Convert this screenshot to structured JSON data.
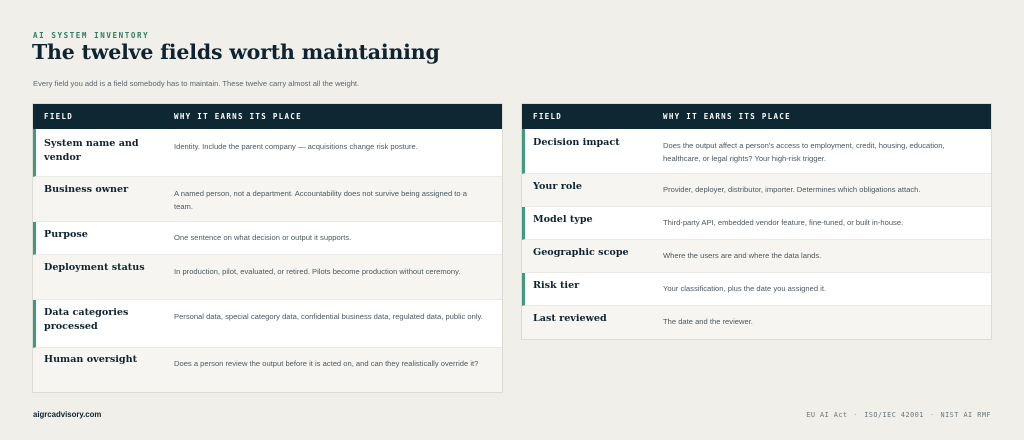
{
  "header": {
    "eyebrow": "AI SYSTEM INVENTORY",
    "title": "The twelve fields worth maintaining",
    "subtitle": "Every field you add is a field somebody has to maintain. These twelve carry almost all the weight."
  },
  "table_headers": {
    "field": "FIELD",
    "why": "WHY IT EARNS ITS PLACE"
  },
  "left_table": {
    "rows": [
      {
        "field": "System name and vendor",
        "why": "Identity. Include the parent company — acquisitions change risk posture."
      },
      {
        "field": "Business owner",
        "why": "A named person, not a department. Accountability does not survive being assigned to a team."
      },
      {
        "field": "Purpose",
        "why": "One sentence on what decision or output it supports."
      },
      {
        "field": "Deployment status",
        "why": "In production, pilot, evaluated, or retired. Pilots become production without ceremony."
      },
      {
        "field": "Data categories processed",
        "why": "Personal data, special category data, confidential business data, regulated data, public only."
      },
      {
        "field": "Human oversight",
        "why": "Does a person review the output before it is acted on, and can they realistically override it?"
      }
    ]
  },
  "right_table": {
    "rows": [
      {
        "field": "Decision impact",
        "why": "Does the output affect a person's access to employment, credit, housing, education, healthcare, or legal rights? Your high-risk trigger."
      },
      {
        "field": "Your role",
        "why": "Provider, deployer, distributor, importer. Determines which obligations attach."
      },
      {
        "field": "Model type",
        "why": "Third-party API, embedded vendor feature, fine-tuned, or built in-house."
      },
      {
        "field": "Geographic scope",
        "why": "Where the users are and where the data lands."
      },
      {
        "field": "Risk tier",
        "why": "Your classification, plus the date you assigned it."
      },
      {
        "field": "Last reviewed",
        "why": "The date and the reviewer."
      }
    ]
  },
  "footer": {
    "site": "aigrcadvisory.com",
    "frameworks": [
      "EU AI Act",
      "ISO/IEC 42001",
      "NIST AI RMF"
    ],
    "separator": "·"
  },
  "colors": {
    "accent": "#3f9b7a",
    "header_bg": "#0d2733",
    "page_bg": "#f0efea"
  }
}
